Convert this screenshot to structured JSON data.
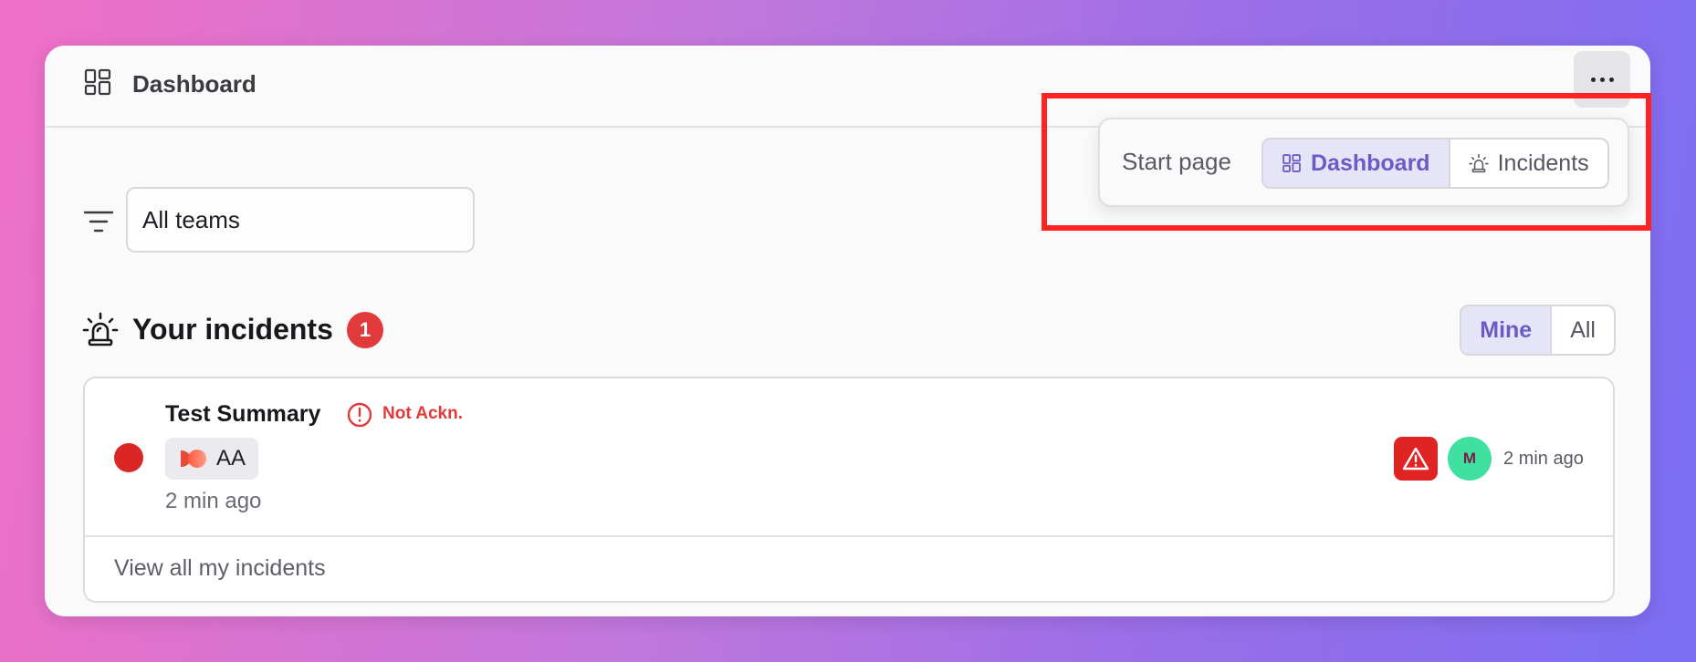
{
  "header": {
    "title": "Dashboard",
    "icon": "dashboard-icon",
    "more_icon": "more-horizontal-icon"
  },
  "filter": {
    "icon": "filter-icon",
    "team_value": "All teams"
  },
  "incidents": {
    "title": "Your incidents",
    "count": "1",
    "scope_options": [
      "Mine",
      "All"
    ],
    "scope_selected": "Mine",
    "items": [
      {
        "title": "Test Summary",
        "status": "Not Ackn.",
        "team": "AA",
        "time": "2 min ago",
        "assignee_initial": "M",
        "right_time": "2 min ago"
      }
    ],
    "view_all_label": "View all my incidents"
  },
  "start_page": {
    "label": "Start page",
    "options": [
      "Dashboard",
      "Incidents"
    ],
    "selected": "Dashboard"
  },
  "colors": {
    "accent": "#6b5bc4",
    "danger": "#e23a3a",
    "avatar": "#3fe0a0",
    "highlight": "#ff2222"
  }
}
